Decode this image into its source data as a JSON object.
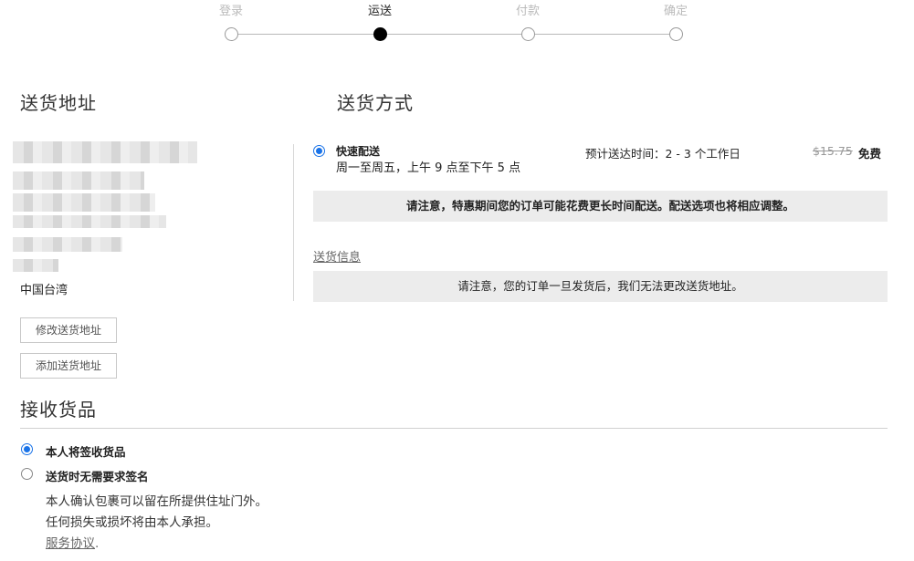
{
  "stepper": {
    "steps": [
      {
        "label": "登录",
        "active": false
      },
      {
        "label": "运送",
        "active": true
      },
      {
        "label": "付款",
        "active": false
      },
      {
        "label": "确定",
        "active": false
      }
    ]
  },
  "address": {
    "title": "送货地址",
    "country": "中国台湾",
    "edit_button": "修改送货地址",
    "add_button": "添加送货地址"
  },
  "shipping": {
    "title": "送货方式",
    "option": {
      "name": "快速配送",
      "hours": "周一至周五，上午 9 点至下午 5 点",
      "eta": "预计送达时间：2 - 3 个工作日",
      "old_price": "$15.75",
      "price": "免费",
      "selected": true
    },
    "promo_notice": "请注意，特惠期间您的订单可能花费更长时间配送。配送选项也将相应调整。",
    "info_link": "送货信息",
    "address_notice": "请注意，您的订单一旦发货后，我们无法更改送货地址。"
  },
  "receive": {
    "title": "接收货品",
    "options": [
      {
        "label": "本人将签收货品",
        "selected": true
      },
      {
        "label": "送货时无需要求签名",
        "selected": false
      }
    ],
    "disclaimer_line1": "本人确认包裹可以留在所提供住址门外。",
    "disclaimer_line2": "任何损失或损坏将由本人承担。",
    "terms_link": "服务协议",
    "terms_suffix": "."
  },
  "colors": {
    "accent": "#1a73e8",
    "notice_bg": "#ececec"
  }
}
